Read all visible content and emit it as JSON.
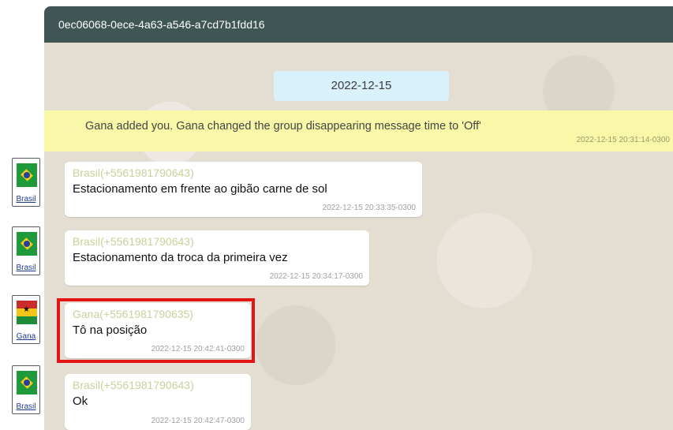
{
  "chat": {
    "title": "0ec06068-0ece-4a63-a546-a7cd7b1fdd16",
    "date_separator": "2022-12-15",
    "system_message": {
      "text": "Gana added you. Gana changed the group disappearing message time to 'Off'",
      "time": "2022-12-15 20:31:14-0300"
    },
    "messages": [
      {
        "avatar_label": "Brasil",
        "flag": "brazil-flag",
        "sender": "Brasil(+5561981790643)",
        "text": "Estacionamento em frente ao gibão carne de sol",
        "time": "2022-12-15 20:33:35-0300"
      },
      {
        "avatar_label": "Brasil",
        "flag": "brazil-flag",
        "sender": "Brasil(+5561981790643)",
        "text": "Estacionamento da troca da primeira vez",
        "time": "2022-12-15 20:34:17-0300"
      },
      {
        "avatar_label": "Gana",
        "flag": "ghana-flag",
        "sender": "Gana(+5561981790635)",
        "text": "Tô na posição",
        "time": "2022-12-15 20:42:41-0300"
      },
      {
        "avatar_label": "Brasil",
        "flag": "brazil-flag",
        "sender": "Brasil(+5561981790643)",
        "text": "Ok",
        "time": "2022-12-15 20:42:47-0300"
      }
    ]
  },
  "colors": {
    "header_bg": "#3f5655",
    "system_banner_bg": "#f8f8a8",
    "date_pill_bg": "#d8f1fb",
    "highlight_border": "#e31414",
    "sender_name": "#c6d29a"
  }
}
